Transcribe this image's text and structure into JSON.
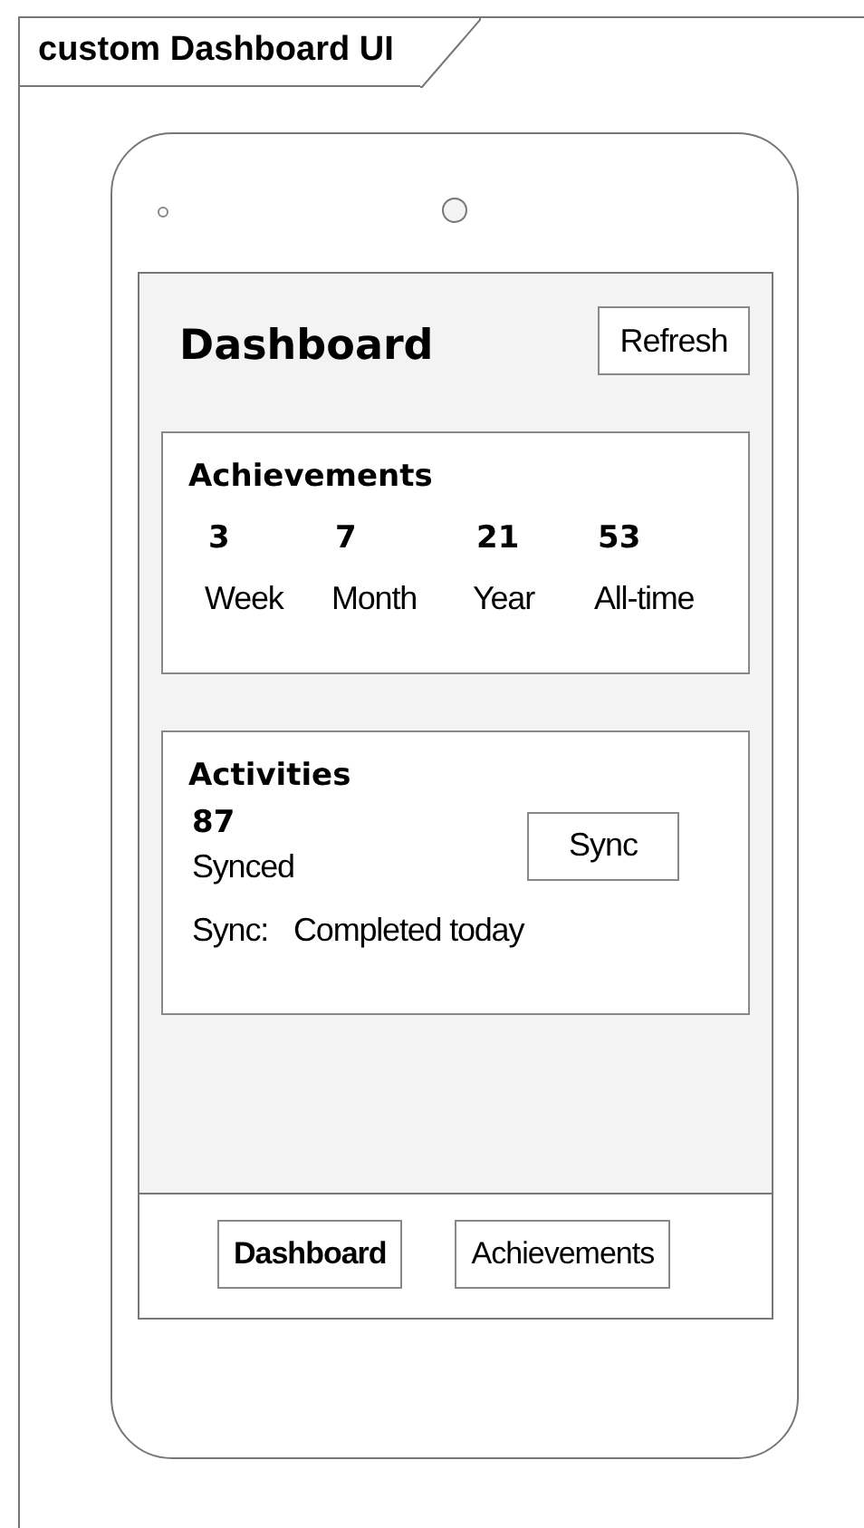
{
  "diagram": {
    "title": "custom Dashboard UI"
  },
  "screen": {
    "title": "Dashboard",
    "refresh_button": "Refresh",
    "achievements": {
      "title": "Achievements",
      "stats": [
        {
          "value": "3",
          "label": "Week"
        },
        {
          "value": "7",
          "label": "Month"
        },
        {
          "value": "21",
          "label": "Year"
        },
        {
          "value": "53",
          "label": "All-time"
        }
      ]
    },
    "activities": {
      "title": "Activities",
      "count": "87",
      "count_label": "Synced",
      "sync_button": "Sync",
      "status_label": "Sync:",
      "status_value": "Completed today"
    },
    "nav": [
      {
        "label": "Dashboard",
        "selected": true
      },
      {
        "label": "Achievements",
        "selected": false
      }
    ]
  }
}
